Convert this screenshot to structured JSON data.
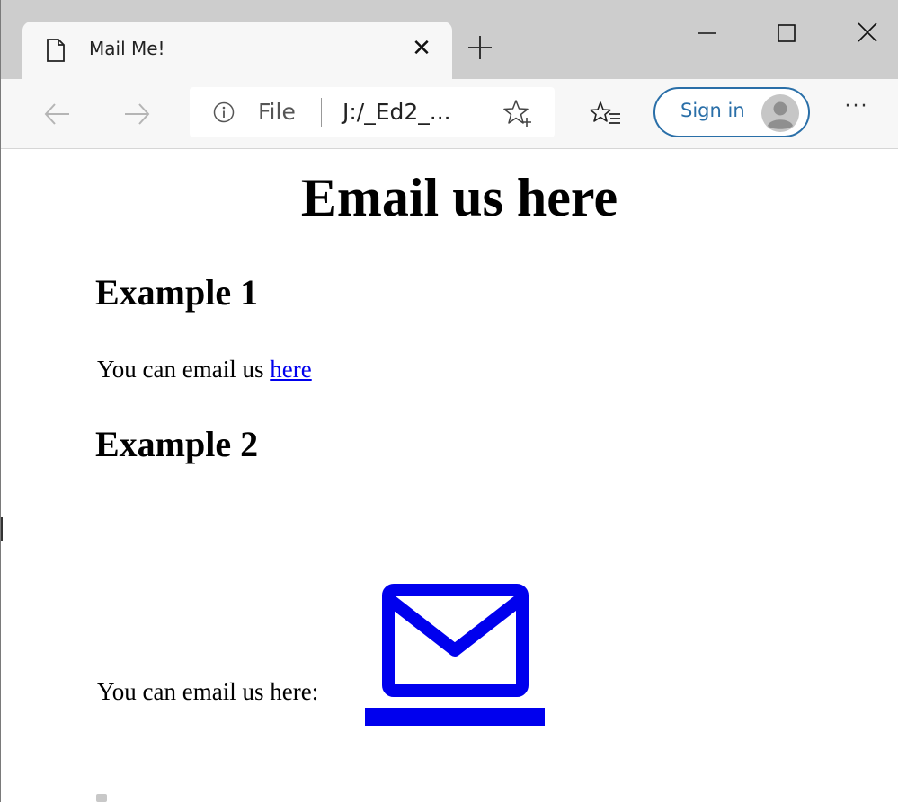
{
  "browser": {
    "tab": {
      "title": "Mail Me!",
      "close_glyph": "✕",
      "icon": "page-icon"
    },
    "new_tab_icon": "plus-icon",
    "window_controls": [
      "minimize-icon",
      "maximize-icon",
      "close-icon"
    ],
    "toolbar": {
      "back_icon": "back-arrow-icon",
      "forward_icon": "forward-arrow-icon",
      "address": {
        "info_icon": "info-icon",
        "scheme": "File",
        "url": "J:/_Ed2_...",
        "favorite_icon": "add-favorite-icon"
      },
      "favorites_icon": "favorites-icon",
      "sign_in": "Sign in",
      "avatar_icon": "avatar-icon",
      "more": "···"
    }
  },
  "page": {
    "heading": "Email us here",
    "example1": {
      "heading": "Example 1",
      "text": "You can email us ",
      "link": "here"
    },
    "example2": {
      "heading": "Example 2",
      "text": "You can email us here:",
      "icon": "mail-icon"
    }
  },
  "colors": {
    "tabstrip": "#cdcdcd",
    "toolbar": "#f7f7f7",
    "link": "#0000ee",
    "mail_icon": "#0000ee",
    "sign_in_accent": "#2a6fa8"
  }
}
